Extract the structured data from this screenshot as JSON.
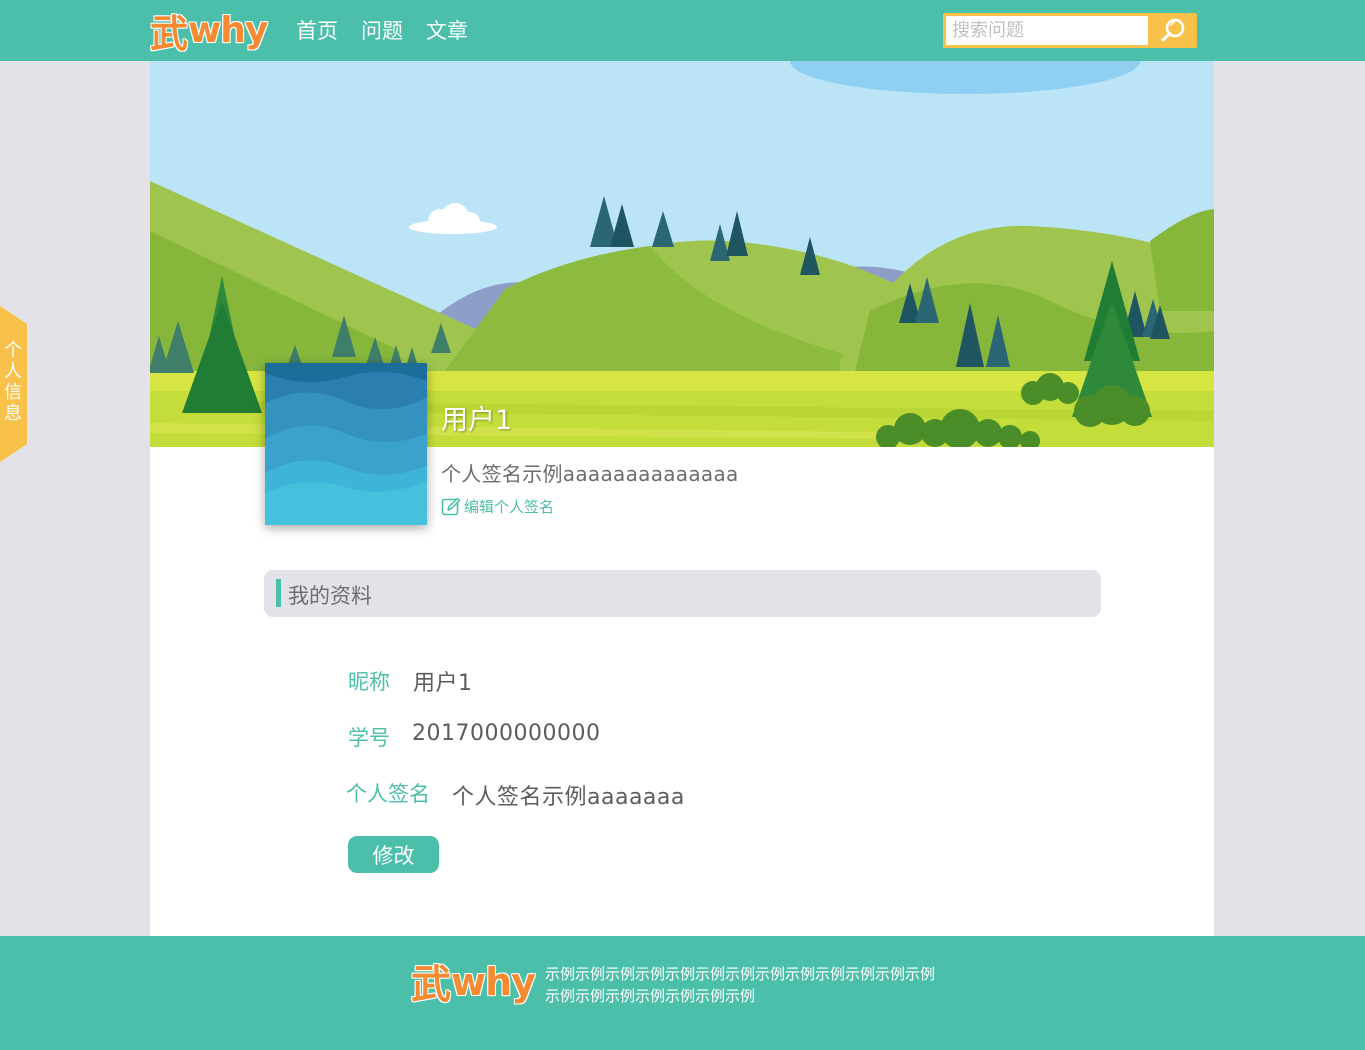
{
  "logo": {
    "char": "武",
    "latin": "why"
  },
  "nav": {
    "items": [
      {
        "label": "首页"
      },
      {
        "label": "问题"
      },
      {
        "label": "文章"
      }
    ]
  },
  "search": {
    "placeholder": "搜索问题",
    "value": ""
  },
  "profile": {
    "username": "用户1",
    "signature": "个人签名示例aaaaaaaaaaaaaa",
    "edit_signature_label": "编辑个人签名"
  },
  "section": {
    "title": "我的资料"
  },
  "fields": {
    "nickname": {
      "label": "昵称",
      "value": "用户1"
    },
    "student_id": {
      "label": "学号",
      "value": "2017000000000"
    },
    "signature": {
      "label": "个人签名",
      "value": "个人签名示例aaaaaaa"
    }
  },
  "modify_button": {
    "label": "修改"
  },
  "sidetab": {
    "label": "个人信息"
  },
  "footer": {
    "text": "示例示例示例示例示例示例示例示例示例示例示例示例示例示例示例示例示例示例示例示例"
  },
  "colors": {
    "primary": "#4cbfaa",
    "accent": "#f7c14a",
    "logo": "#f68a33",
    "background": "#e4e2e9"
  },
  "icons": {
    "search": "search-icon",
    "edit": "edit-icon",
    "banner": "landscape-banner"
  }
}
